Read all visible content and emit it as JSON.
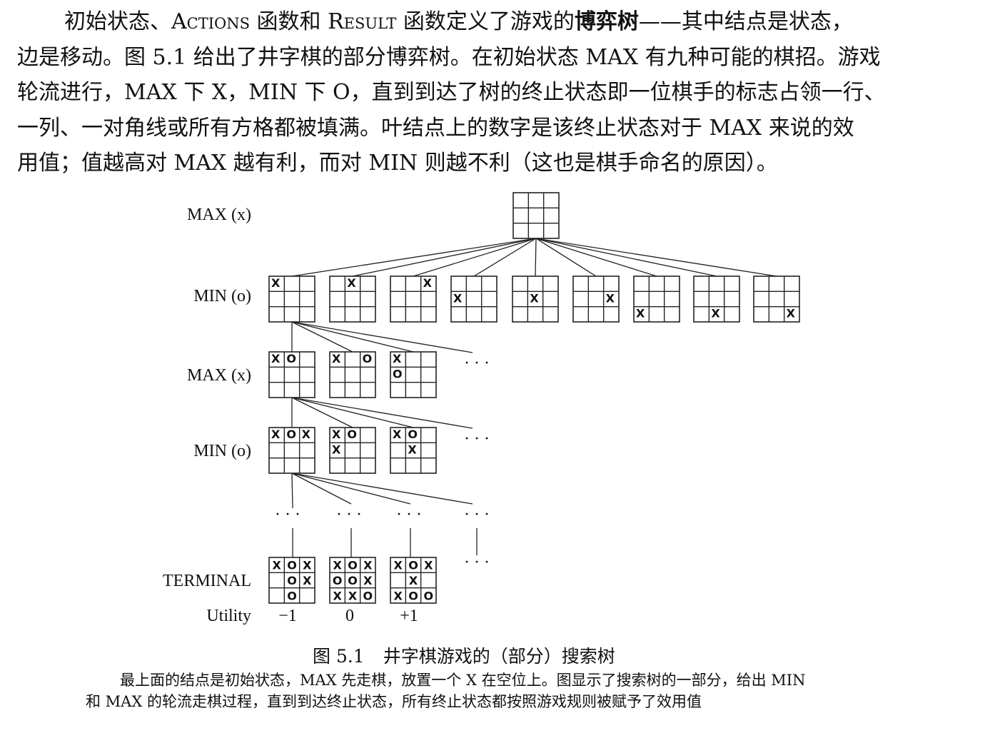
{
  "paragraph": {
    "line1_a": "初始状态、",
    "line1_actions": "Actions",
    "line1_b": " 函数和 ",
    "line1_result": "Result",
    "line1_c": " 函数定义了游戏的",
    "line1_bold": "博弈树",
    "line1_d": "——其中结点是状态，",
    "line2": "边是移动。图 5.1 给出了井字棋的部分博弈树。在初始状态 MAX 有九种可能的棋招。游戏",
    "line3": "轮流进行，MAX 下 X，MIN 下 O，直到到达了树的终止状态即一位棋手的标志占领一行、",
    "line4": "一列、一对角线或所有方格都被填满。叶结点上的数字是该终止状态对于 MAX 来说的效",
    "line5": "用值；值越高对 MAX 越有利，而对 MIN 则越不利（这也是棋手命名的原因）。"
  },
  "figure": {
    "levels": [
      "MAX (x)",
      "MIN (o)",
      "MAX (x)",
      "MIN (o)",
      "TERMINAL"
    ],
    "utility_label": "Utility",
    "ellipsis": "· · ·",
    "boards": {
      "root": [
        "",
        "",
        "",
        "",
        "",
        "",
        "",
        "",
        ""
      ],
      "min_level": [
        [
          "X",
          "",
          "",
          "",
          "",
          "",
          "",
          "",
          ""
        ],
        [
          "",
          "X",
          "",
          "",
          "",
          "",
          "",
          "",
          ""
        ],
        [
          "",
          "",
          "X",
          "",
          "",
          "",
          "",
          "",
          ""
        ],
        [
          "",
          "",
          "",
          "X",
          "",
          "",
          "",
          "",
          ""
        ],
        [
          "",
          "",
          "",
          "",
          "X",
          "",
          "",
          "",
          ""
        ],
        [
          "",
          "",
          "",
          "",
          "",
          "X",
          "",
          "",
          ""
        ],
        [
          "",
          "",
          "",
          "",
          "",
          "",
          "X",
          "",
          ""
        ],
        [
          "",
          "",
          "",
          "",
          "",
          "",
          "",
          "X",
          ""
        ],
        [
          "",
          "",
          "",
          "",
          "",
          "",
          "",
          "",
          "X"
        ]
      ],
      "max_level": [
        [
          "X",
          "O",
          "",
          "",
          "",
          "",
          "",
          "",
          ""
        ],
        [
          "X",
          "",
          "O",
          "",
          "",
          "",
          "",
          "",
          ""
        ],
        [
          "X",
          "",
          "",
          "O",
          "",
          "",
          "",
          "",
          ""
        ]
      ],
      "min2_level": [
        [
          "X",
          "O",
          "X",
          "",
          "",
          "",
          "",
          "",
          ""
        ],
        [
          "X",
          "O",
          "",
          "X",
          "",
          "",
          "",
          "",
          ""
        ],
        [
          "X",
          "O",
          "",
          "",
          "X",
          "",
          "",
          "",
          ""
        ]
      ],
      "terminal_level": [
        [
          "X",
          "O",
          "X",
          "",
          "O",
          "X",
          "",
          "O",
          ""
        ],
        [
          "X",
          "O",
          "X",
          "O",
          "O",
          "X",
          "X",
          "X",
          "O"
        ],
        [
          "X",
          "O",
          "X",
          "",
          "X",
          "",
          "X",
          "O",
          "O"
        ]
      ]
    },
    "utilities": [
      "−1",
      "0",
      "+1"
    ]
  },
  "caption": {
    "number": "图 5.1",
    "title": "井字棋游戏的（部分）搜索树",
    "line1": "最上面的结点是初始状态，MAX 先走棋，放置一个 X 在空位上。图显示了搜索树的一部分，给出 MIN",
    "line2": "和 MAX 的轮流走棋过程，直到到达终止状态，所有终止状态都按照游戏规则被赋予了效用值"
  }
}
